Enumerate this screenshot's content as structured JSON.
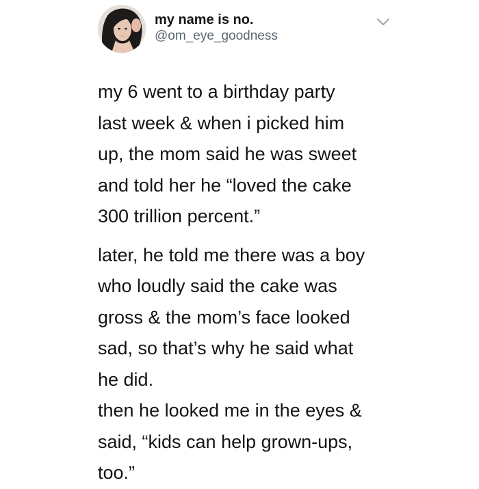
{
  "tweet": {
    "author": {
      "display_name": "my name is no.",
      "handle": "@om_eye_goodness",
      "avatar_icon": "profile-photo"
    },
    "menu_icon": "chevron-down-icon",
    "paragraphs": [
      {
        "lines": [
          "my 6 went to a birthday party",
          "last week & when i picked him",
          "up, the mom said he was sweet",
          "and told her he “loved the cake",
          "300 trillion percent.”"
        ]
      },
      {
        "lines": [
          "later, he told me there was a boy",
          "who loudly said the cake was",
          "gross & the mom’s face looked",
          "sad, so that’s why he said what",
          "he did."
        ]
      },
      {
        "lines": [
          "then he looked me in the eyes &",
          "said, “kids can help grown-ups,",
          "too.”"
        ]
      }
    ]
  },
  "colors": {
    "text": "#141414",
    "handle": "#5b6670",
    "chevron": "#9aa5b0",
    "background": "#ffffff"
  }
}
